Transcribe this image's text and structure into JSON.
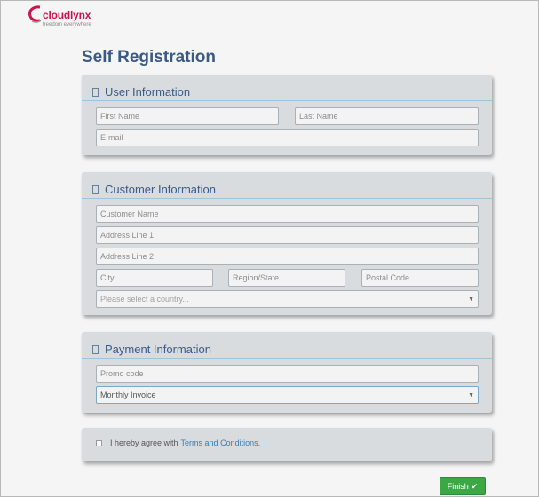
{
  "brand": {
    "name": "cloudlynx",
    "tagline": "freedom everywhere",
    "colors": {
      "primary": "#c8174a",
      "heading": "#3b5a85",
      "link": "#2d7fc1",
      "finish": "#3aa844"
    }
  },
  "page": {
    "title": "Self Registration"
  },
  "user_info": {
    "heading": "User Information",
    "icon": "section-icon",
    "first_name_placeholder": "First Name",
    "last_name_placeholder": "Last Name",
    "email_placeholder": "E-mail"
  },
  "customer_info": {
    "heading": "Customer Information",
    "icon": "section-icon",
    "customer_name_placeholder": "Customer Name",
    "address1_placeholder": "Address Line 1",
    "address2_placeholder": "Address Line 2",
    "city_placeholder": "City",
    "region_placeholder": "Region/State",
    "postal_placeholder": "Postal Code",
    "country_placeholder": "Please select a country..."
  },
  "payment_info": {
    "heading": "Payment Information",
    "icon": "section-icon",
    "promo_placeholder": "Promo code",
    "payment_method_value": "Monthly Invoice"
  },
  "agreement": {
    "prefix": "I hereby agree with",
    "link_text": "Terms and Conditions.",
    "checked": false
  },
  "actions": {
    "finish_label": "Finish",
    "finish_icon": "check-icon"
  }
}
